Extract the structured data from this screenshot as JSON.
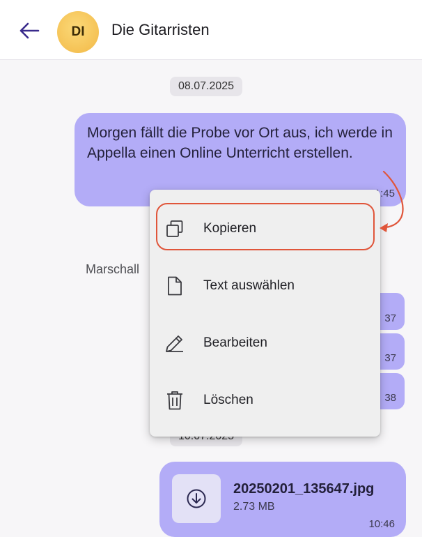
{
  "header": {
    "avatar_initials": "DI",
    "title": "Die Gitarristen"
  },
  "messages": {
    "date_1": "08.07.2025",
    "msg_1_text": "Morgen fällt die Probe vor Ort aus, ich werde in Appella einen Online Unterricht erstellen.",
    "msg_1_time": "11:45",
    "sender_label": "Marschall",
    "small_1_time": "37",
    "small_2_time": "37",
    "small_3_time": "38",
    "date_2": "10.07.2025",
    "file_name": "20250201_135647.jpg",
    "file_size": "2.73 MB",
    "file_time": "10:46"
  },
  "context_menu": {
    "items": [
      {
        "label": "Kopieren",
        "icon": "copy-icon"
      },
      {
        "label": "Text auswählen",
        "icon": "document-icon"
      },
      {
        "label": "Bearbeiten",
        "icon": "pencil-icon"
      },
      {
        "label": "Löschen",
        "icon": "trash-icon"
      }
    ]
  },
  "colors": {
    "bubble": "#b3acf7",
    "accent": "#3a2b8c",
    "annotation": "#e0553a"
  }
}
